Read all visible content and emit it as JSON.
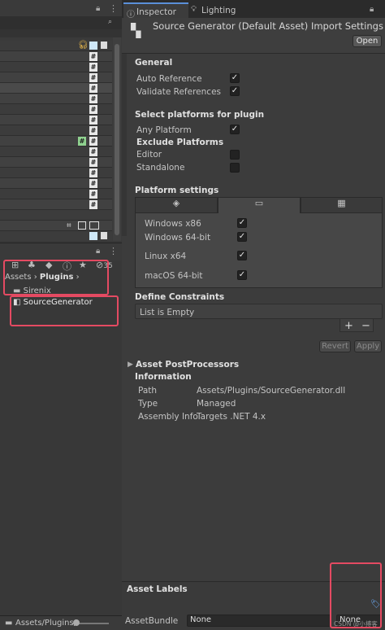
{
  "tabs": {
    "inspector": "Inspector",
    "lighting": "Lighting"
  },
  "header": {
    "title": "Source Generator (Default Asset) Import Settings",
    "open_button": "Open"
  },
  "general": {
    "heading": "General",
    "auto_reference": "Auto Reference",
    "validate_references": "Validate References",
    "auto_reference_checked": true,
    "validate_references_checked": true
  },
  "platforms": {
    "heading": "Select platforms for plugin",
    "any_platform": "Any Platform",
    "any_platform_checked": true,
    "exclude_heading": "Exclude Platforms",
    "editor": "Editor",
    "standalone": "Standalone"
  },
  "platform_settings": {
    "heading": "Platform settings",
    "windows_x86": "Windows x86",
    "windows_64": "Windows 64-bit",
    "linux_x64": "Linux x64",
    "macos_64": "macOS 64-bit"
  },
  "constraints": {
    "heading": "Define Constraints",
    "list_empty": "List is Empty",
    "plus": "+",
    "minus": "−"
  },
  "actions": {
    "revert": "Revert",
    "apply": "Apply"
  },
  "post": {
    "heading": "Asset PostProcessors"
  },
  "info": {
    "heading": "Information",
    "path_label": "Path",
    "path_value": "Assets/Plugins/SourceGenerator.dll",
    "type_label": "Type",
    "type_value": "Managed",
    "assembly_label": "Assembly Info",
    "assembly_value": "Targets .NET 4.x"
  },
  "labels": {
    "heading": "Asset Labels",
    "bundle_label": "AssetBundle",
    "bundle_value": "None",
    "bundle_value2": "None"
  },
  "project": {
    "crumb_assets": "Assets",
    "crumb_plugins": "Plugins",
    "folder_sirenix": "Sirenix",
    "file_sg": "SourceGenerator",
    "count": "35",
    "bottom_path": "Assets/Plugins/"
  },
  "hierarchy": {
    "hash": "#"
  },
  "watermark": "CSDN @小搏客"
}
